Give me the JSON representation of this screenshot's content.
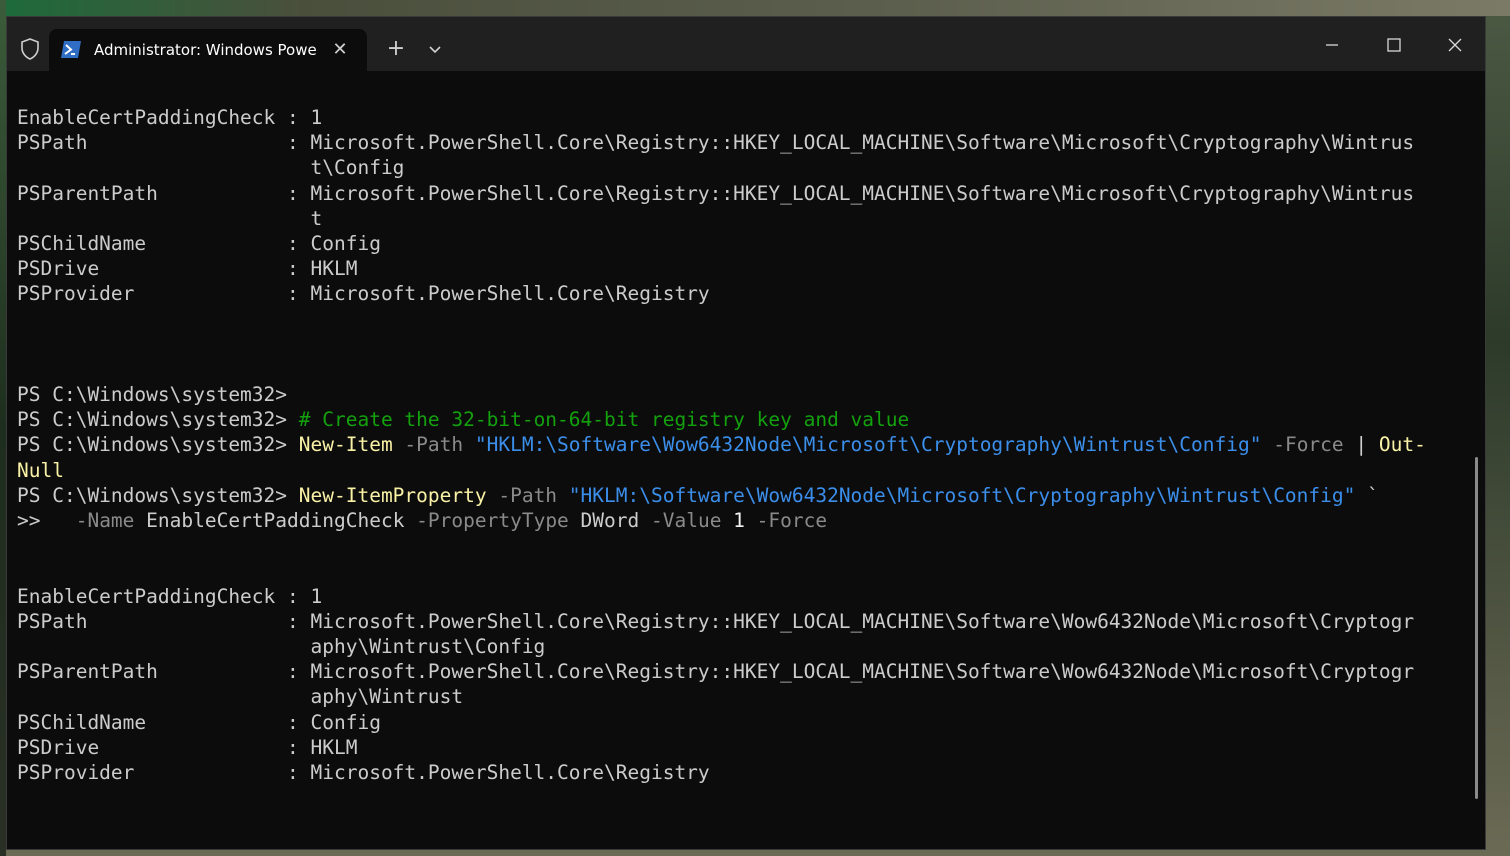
{
  "window": {
    "tab_title": "Administrator: Windows PowerShell",
    "tab_close": "✕",
    "new_tab": "+",
    "icons": {
      "shield": "shield-icon",
      "powershell": "powershell-icon",
      "dropdown": "chevron-down-icon",
      "minimize": "minimize-icon",
      "maximize": "maximize-icon",
      "close": "close-icon"
    }
  },
  "colors": {
    "terminal_bg": "#0c0c0c",
    "titlebar_bg": "#202020",
    "cmdlet": "#f9f1a5",
    "parameter": "#8a8a8a",
    "string": "#3b8eea",
    "comment": "#13a10e",
    "text": "#cccccc"
  },
  "terminal": {
    "lines": [
      [
        {
          "t": "EnableCertPaddingCheck : 1",
          "c": "default"
        }
      ],
      [
        {
          "t": "PSPath                 : Microsoft.PowerShell.Core\\Registry::HKEY_LOCAL_MACHINE\\Software\\Microsoft\\Cryptography\\Wintrus",
          "c": "default"
        }
      ],
      [
        {
          "t": "                         t\\Config",
          "c": "default"
        }
      ],
      [
        {
          "t": "PSParentPath           : Microsoft.PowerShell.Core\\Registry::HKEY_LOCAL_MACHINE\\Software\\Microsoft\\Cryptography\\Wintrus",
          "c": "default"
        }
      ],
      [
        {
          "t": "                         t",
          "c": "default"
        }
      ],
      [
        {
          "t": "PSChildName            : Config",
          "c": "default"
        }
      ],
      [
        {
          "t": "PSDrive                : HKLM",
          "c": "default"
        }
      ],
      [
        {
          "t": "PSProvider             : Microsoft.PowerShell.Core\\Registry",
          "c": "default"
        }
      ],
      [],
      [],
      [],
      [
        {
          "t": "PS C:\\Windows\\system32> ",
          "c": "default"
        }
      ],
      [
        {
          "t": "PS C:\\Windows\\system32> ",
          "c": "default"
        },
        {
          "t": "# Create the 32-bit-on-64-bit registry key and value",
          "c": "comment"
        }
      ],
      [
        {
          "t": "PS C:\\Windows\\system32> ",
          "c": "default"
        },
        {
          "t": "New-Item",
          "c": "cmd"
        },
        {
          "t": " -Path ",
          "c": "param"
        },
        {
          "t": "\"HKLM:\\Software\\Wow6432Node\\Microsoft\\Cryptography\\Wintrust\\Config\"",
          "c": "str"
        },
        {
          "t": " -Force ",
          "c": "param"
        },
        {
          "t": "| ",
          "c": "op"
        },
        {
          "t": "Out-",
          "c": "cmd"
        }
      ],
      [
        {
          "t": "Null",
          "c": "cmd"
        }
      ],
      [
        {
          "t": "PS C:\\Windows\\system32> ",
          "c": "default"
        },
        {
          "t": "New-ItemProperty",
          "c": "cmd"
        },
        {
          "t": " -Path ",
          "c": "param"
        },
        {
          "t": "\"HKLM:\\Software\\Wow6432Node\\Microsoft\\Cryptography\\Wintrust\\Config\"",
          "c": "str"
        },
        {
          "t": " `",
          "c": "op"
        }
      ],
      [
        {
          "t": ">> ",
          "c": "default"
        },
        {
          "t": "  -Name ",
          "c": "param"
        },
        {
          "t": "EnableCertPaddingCheck",
          "c": "default"
        },
        {
          "t": " -PropertyType ",
          "c": "param"
        },
        {
          "t": "DWord",
          "c": "default"
        },
        {
          "t": " -Value ",
          "c": "param"
        },
        {
          "t": "1",
          "c": "num"
        },
        {
          "t": " -Force",
          "c": "param"
        }
      ],
      [],
      [],
      [
        {
          "t": "EnableCertPaddingCheck : 1",
          "c": "default"
        }
      ],
      [
        {
          "t": "PSPath                 : Microsoft.PowerShell.Core\\Registry::HKEY_LOCAL_MACHINE\\Software\\Wow6432Node\\Microsoft\\Cryptogr",
          "c": "default"
        }
      ],
      [
        {
          "t": "                         aphy\\Wintrust\\Config",
          "c": "default"
        }
      ],
      [
        {
          "t": "PSParentPath           : Microsoft.PowerShell.Core\\Registry::HKEY_LOCAL_MACHINE\\Software\\Wow6432Node\\Microsoft\\Cryptogr",
          "c": "default"
        }
      ],
      [
        {
          "t": "                         aphy\\Wintrust",
          "c": "default"
        }
      ],
      [
        {
          "t": "PSChildName            : Config",
          "c": "default"
        }
      ],
      [
        {
          "t": "PSDrive                : HKLM",
          "c": "default"
        }
      ],
      [
        {
          "t": "PSProvider             : Microsoft.PowerShell.Core\\Registry",
          "c": "default"
        }
      ]
    ]
  }
}
